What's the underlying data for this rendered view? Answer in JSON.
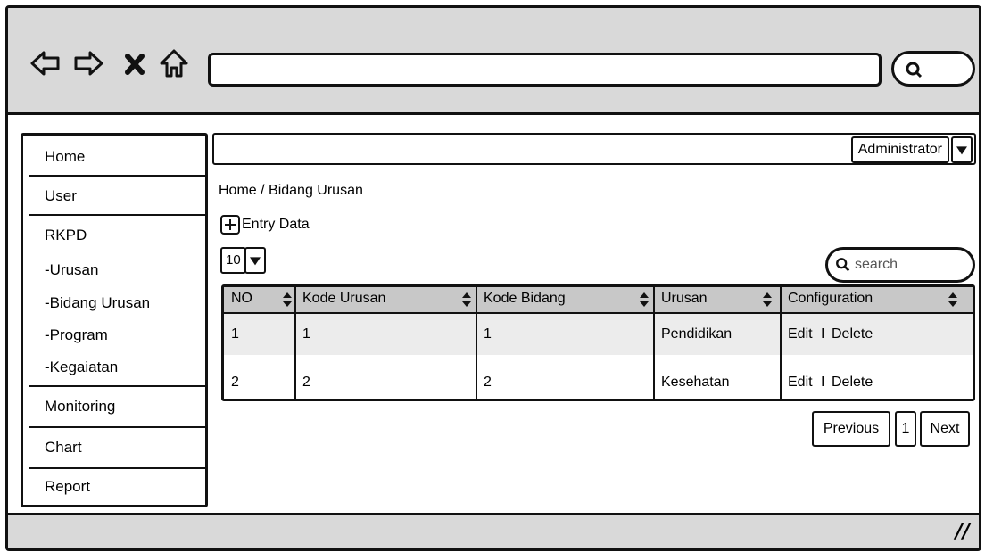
{
  "browser": {
    "back_icon": "back-arrow-icon",
    "forward_icon": "forward-arrow-icon",
    "stop_icon": "close-icon",
    "home_icon": "home-icon",
    "url": "",
    "search_icon": "search-icon"
  },
  "sidebar": {
    "items": [
      {
        "label": "Home"
      },
      {
        "label": "User"
      },
      {
        "label": "RKPD"
      },
      {
        "label": "-Urusan"
      },
      {
        "label": "-Bidang Urusan"
      },
      {
        "label": "-Program"
      },
      {
        "label": "-Kegaiatan"
      },
      {
        "label": "Monitoring"
      },
      {
        "label": "Chart"
      },
      {
        "label": "Report"
      }
    ]
  },
  "topbar": {
    "user_select": "Administrator"
  },
  "breadcrumb": "Home / Bidang Urusan",
  "entry_label": "Entry Data",
  "page_size": "10",
  "search": {
    "placeholder": "search"
  },
  "table": {
    "columns": [
      "NO",
      "Kode Urusan",
      "Kode Bidang",
      "Urusan",
      "Configuration"
    ],
    "rows": [
      {
        "no": "1",
        "kode_urusan": "1",
        "kode_bidang": "1",
        "urusan": "Pendidikan",
        "edit": "Edit",
        "sep": "I",
        "delete": "Delete"
      },
      {
        "no": "2",
        "kode_urusan": "2",
        "kode_bidang": "2",
        "urusan": "Kesehatan",
        "edit": "Edit",
        "sep": "I",
        "delete": "Delete"
      }
    ]
  },
  "pagination": {
    "previous": "Previous",
    "current": "1",
    "next": "Next"
  },
  "colors": {
    "chrome": "#d9d9d9",
    "table_header": "#c8c8c8",
    "row_alt": "#ececec",
    "border": "#111111"
  }
}
